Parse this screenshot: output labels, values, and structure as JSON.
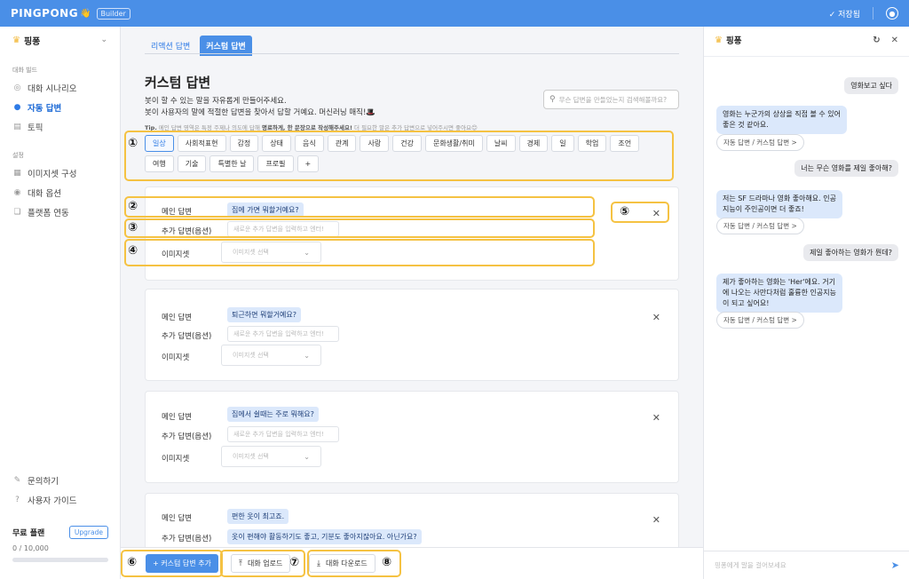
{
  "topbar": {
    "logo": "PINGPONG",
    "logo_emoji": "👋",
    "badge": "Builder",
    "save_label": "✓ 저장됨"
  },
  "sidebar": {
    "bot_name": "핑퐁",
    "section_build": "대화 빌드",
    "build_items": [
      {
        "label": "대화 시나리오",
        "icon": "chat-bubble-icon"
      },
      {
        "label": "자동 답변",
        "icon": "auto-reply-icon",
        "active": true
      },
      {
        "label": "토픽",
        "icon": "topic-icon"
      }
    ],
    "section_settings": "설정",
    "settings_items": [
      {
        "label": "이미지셋 구성",
        "icon": "image-icon"
      },
      {
        "label": "대화 옵션",
        "icon": "option-icon"
      },
      {
        "label": "플랫폼 연동",
        "icon": "platform-icon"
      }
    ],
    "bottom_items": [
      {
        "label": "문의하기",
        "icon": "pencil-icon"
      },
      {
        "label": "사용자 가이드",
        "icon": "help-icon"
      }
    ],
    "plan": {
      "name": "무료 플랜",
      "upgrade": "Upgrade",
      "usage": "0 / 10,000",
      "usage_fraction": 0
    }
  },
  "main": {
    "tabs": [
      {
        "label": "리액션 답변"
      },
      {
        "label": "커스텀 답변",
        "active": true
      }
    ],
    "title": "커스텀 답변",
    "desc_line1": "봇이 할 수 있는 말을 자유롭게 만들어주세요.",
    "desc_line2": "봇이 사용자의 말에 적절한 답변을 찾아서 답할 거예요. 머신러닝 매직!🎩",
    "tip_prefix": "Tip.",
    "tip_text": "메인 답변 영역은 특정 주제나 의도에 답해",
    "tip_bold": "명료하게, 한 문장으로 작성해주세요!",
    "tip_suffix": "더 필요한 말은 추가 답변으로 넣어주시면 좋아요😊",
    "search_placeholder": "무슨 답변을 만들었는지 검색해볼까요?",
    "categories": [
      "일상",
      "사회적표현",
      "감정",
      "상태",
      "음식",
      "관계",
      "사랑",
      "건강",
      "문화생활/취미",
      "날씨",
      "경제",
      "일",
      "학업",
      "조언",
      "여행",
      "기술",
      "특별한 날",
      "프로필",
      "+"
    ],
    "labels": {
      "main": "메인 답변",
      "extra": "추가 답변(옵션)",
      "imageset": "이미지셋"
    },
    "extra_placeholder": "새로운 추가 답변을 입력하고 엔터!",
    "imageset_placeholder": "이미지셋 선택",
    "cards": [
      {
        "main": "집에 가면 뭐할거예요?"
      },
      {
        "main": "퇴근하면 뭐할거예요?"
      },
      {
        "main": "집에서 쉴때는 주로 뭐해요?"
      },
      {
        "main": "편한 옷이 최고죠.",
        "extra": "옷이 편해야 활동하기도 좋고, 기분도 좋아지잖아요. 아닌가요?"
      }
    ],
    "markers": [
      "①",
      "②",
      "③",
      "④",
      "⑤",
      "⑥",
      "⑦",
      "⑧"
    ],
    "buttons": {
      "add": "+ 커스텀 답변 추가",
      "upload": "대화 업로드",
      "download": "대화 다운로드"
    }
  },
  "chat": {
    "title": "핑퐁",
    "messages": [
      {
        "side": "r",
        "text": "영화보고 싶다"
      },
      {
        "side": "l",
        "lines": [
          "영화는 누군가의 상상을 직접 볼 수 있어",
          "좋은 것 같아요."
        ]
      },
      {
        "side": "s",
        "text": "자동 답변 / 커스텀 답변 >"
      },
      {
        "side": "r",
        "text": "너는 무슨 영화를 제일 좋아해?"
      },
      {
        "side": "l",
        "lines": [
          "저는 SF 드라마나 영화 좋아해요. 인공",
          "지능이 주인공이면 더 좋죠!"
        ]
      },
      {
        "side": "s",
        "text": "자동 답변 / 커스텀 답변 >"
      },
      {
        "side": "r",
        "text": "제일 좋아하는 영화가 뭔데?"
      },
      {
        "side": "l",
        "lines": [
          "제가 좋아하는 영화는 'Her'에요. 거기",
          "에 나오는 사만다처럼 훌륭한 인공지능",
          "이 되고 싶어요!"
        ]
      },
      {
        "side": "s",
        "text": "자동 답변 / 커스텀 답변 >"
      }
    ],
    "input_placeholder": "핑퐁에게 말을 걸어보세요"
  }
}
